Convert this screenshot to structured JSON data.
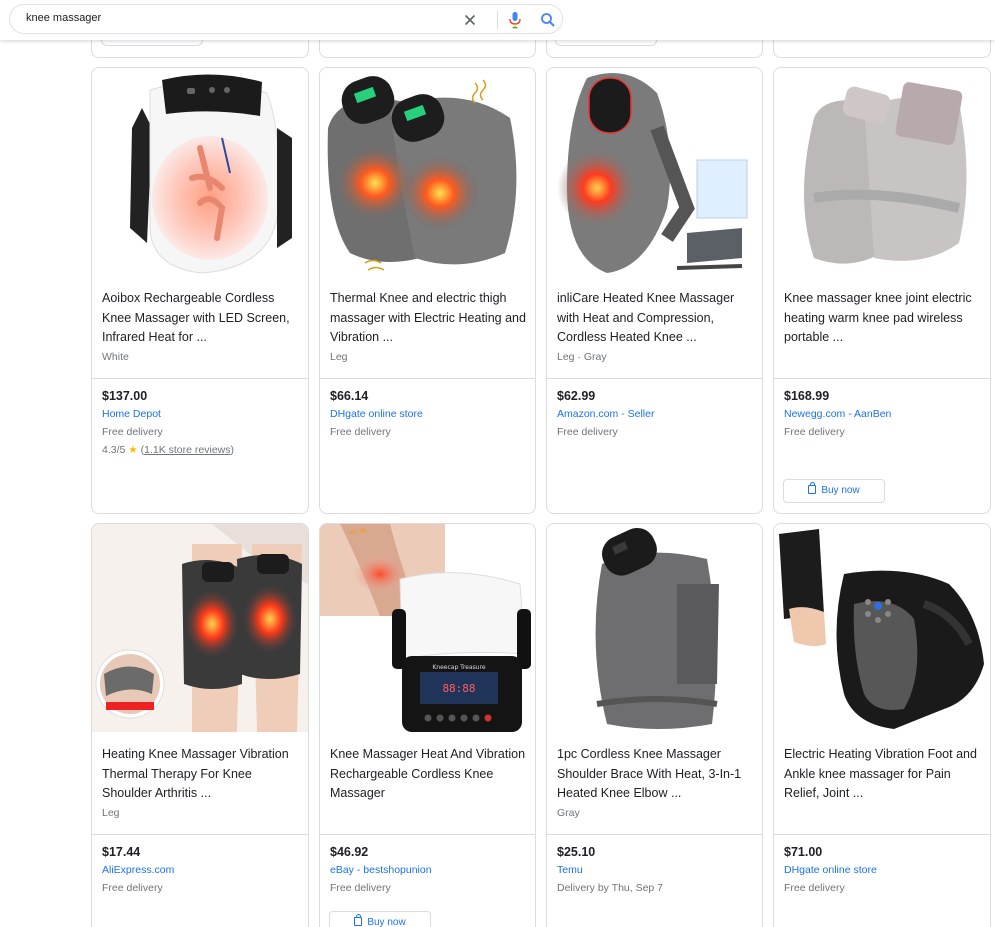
{
  "search": {
    "query": "knee massager"
  },
  "products": [
    {
      "title": "Aoibox Rechargeable Cordless Knee Massager with LED Screen, Infrared Heat for ...",
      "variant": "White",
      "price": "$137.00",
      "store": "Home Depot",
      "delivery": "Free delivery",
      "rating": "4.3/5",
      "rating_open": "(",
      "reviews": "1.1K store reviews",
      "rating_close": ")"
    },
    {
      "title": "Thermal Knee and electric thigh massager with Electric Heating and Vibration ...",
      "variant": "Leg",
      "price": "$66.14",
      "store": "DHgate online store",
      "delivery": "Free delivery"
    },
    {
      "title": "inliCare Heated Knee Massager with Heat and Compression, Cordless Heated Knee ...",
      "variant": "Leg · Gray",
      "price": "$62.99",
      "store": "Amazon.com - Seller",
      "delivery": "Free delivery"
    },
    {
      "title": "Knee massager knee joint electric heating warm knee pad wireless portable ...",
      "variant": "",
      "price": "$168.99",
      "store": "Newegg.com - AanBen",
      "delivery": "Free delivery",
      "buy_label": "Buy now"
    },
    {
      "title": "Heating Knee Massager Vibration Thermal Therapy For Knee Shoulder Arthritis ...",
      "variant": "Leg",
      "price": "$17.44",
      "store": "AliExpress.com",
      "delivery": "Free delivery"
    },
    {
      "title": "Knee Massager Heat And Vibration Rechargeable Cordless Knee Massager",
      "variant": "",
      "price": "$46.92",
      "store": "eBay - bestshopunion",
      "delivery": "Free delivery",
      "buy_label": "Buy now"
    },
    {
      "title": "1pc Cordless Knee Massager Shoulder Brace With Heat, 3-In-1 Heated Knee Elbow ...",
      "variant": "Gray",
      "price": "$25.10",
      "store": "Temu",
      "delivery": "Delivery by Thu, Sep 7"
    },
    {
      "title": "Electric Heating Vibration Foot and Ankle knee massager for Pain Relief, Joint ...",
      "variant": "",
      "price": "$71.00",
      "store": "DHgate online store",
      "delivery": "Free delivery"
    }
  ],
  "image_texts": {
    "kneecap_brand": "Kneecap Treasure",
    "kneecap_display": "88:88"
  },
  "colors": {
    "link": "#1a73e8",
    "star": "#fbbc04",
    "border": "#dadce0"
  }
}
